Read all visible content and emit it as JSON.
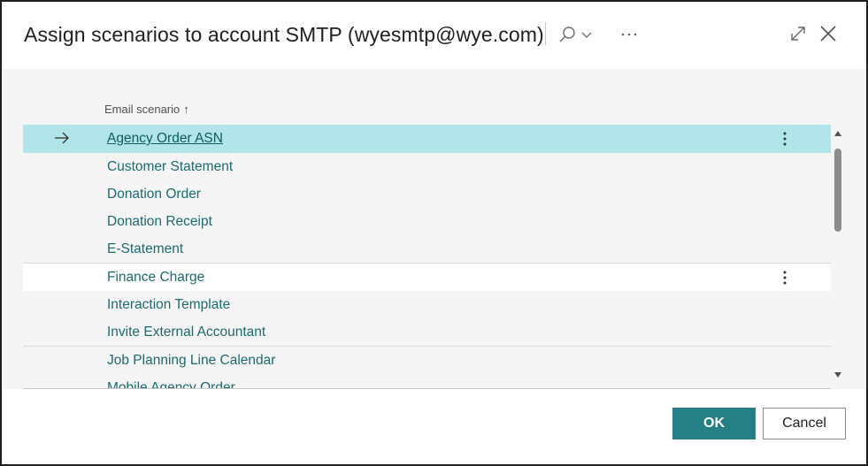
{
  "dialog": {
    "title": "Assign scenarios to account SMTP (wyesmtp@wye.com)",
    "icons": {
      "search": "search-icon",
      "dropdown": "chevron-down-icon",
      "more": "more-options-icon",
      "expand": "expand-icon",
      "close": "close-icon"
    }
  },
  "list": {
    "column_header": "Email scenario",
    "sort_indicator": "↑",
    "rows": [
      {
        "label": "Agency Order ASN",
        "selected": true
      },
      {
        "label": "Customer Statement"
      },
      {
        "label": "Donation Order"
      },
      {
        "label": "Donation Receipt"
      },
      {
        "label": "E-Statement"
      },
      {
        "label": "Finance Charge",
        "hover": true
      },
      {
        "label": "Interaction Template"
      },
      {
        "label": "Invite External Accountant"
      },
      {
        "label": "Job Planning Line Calendar"
      },
      {
        "label": "Mobile Agency Order"
      }
    ]
  },
  "footer": {
    "ok_label": "OK",
    "cancel_label": "Cancel"
  },
  "colors": {
    "accent": "#267f85",
    "selected_row": "#b2e5ea",
    "link_text": "#1d6b6f"
  }
}
